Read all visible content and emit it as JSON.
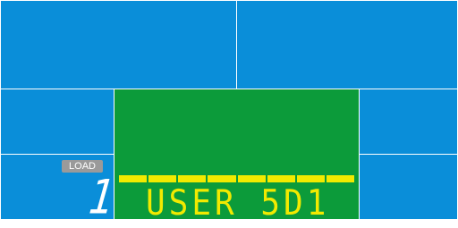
{
  "load": {
    "badge_label": "LOAD",
    "value": "1"
  },
  "lcd": {
    "message": "USER 5D1",
    "progress_segments": 8,
    "progress_filled": 8
  },
  "colors": {
    "panel": "#0a8ed9",
    "lcd": "#0c9b3a",
    "lcd_text": "#f2ea00",
    "badge": "#9a9a9a"
  }
}
